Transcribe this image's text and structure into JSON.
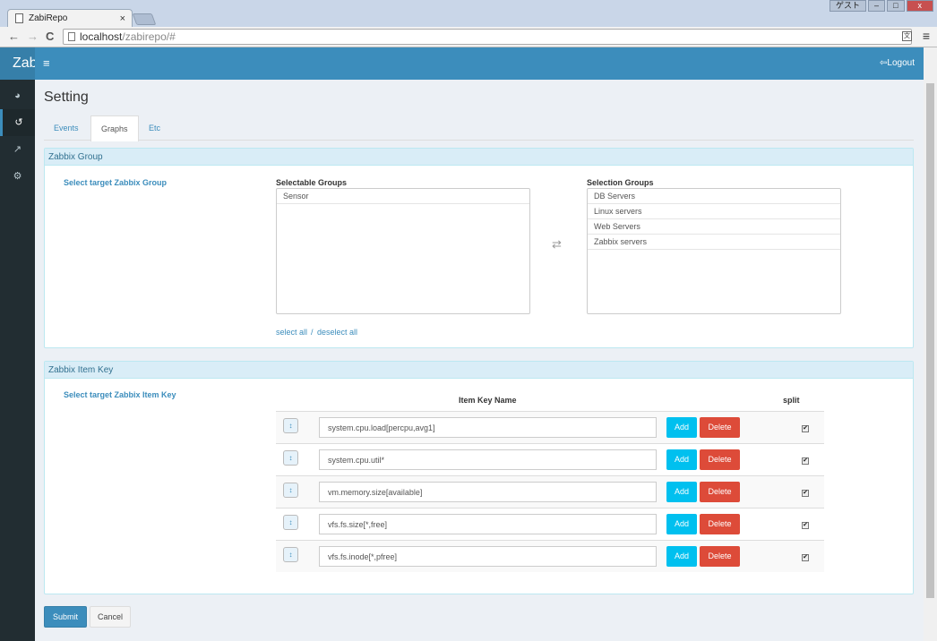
{
  "browser": {
    "tab_title": "ZabiRepo",
    "tab_close": "×",
    "window_buttons": [
      "ゲスト",
      "–",
      "□",
      "x"
    ],
    "address_host": "localhost",
    "address_path": "/zabirepo/#",
    "back": "←",
    "forward": "→",
    "reload": "C",
    "menu": "≡"
  },
  "header": {
    "brand": "Zab",
    "menu_toggle": "≡",
    "logout": "Logout"
  },
  "sidebar": {
    "items": [
      {
        "icon": "dashboard-icon",
        "glyph": "◕"
      },
      {
        "icon": "history-icon",
        "glyph": "↺"
      },
      {
        "icon": "line-chart-icon",
        "glyph": "↗"
      },
      {
        "icon": "cogs-icon",
        "glyph": "⚙"
      }
    ],
    "active_index": 1
  },
  "page": {
    "title": "Setting",
    "tabs": [
      {
        "label": "Events"
      },
      {
        "label": "Graphs",
        "active": true
      },
      {
        "label": "Etc"
      }
    ]
  },
  "group_panel": {
    "heading": "Zabbix Group",
    "target_label": "Select target Zabbix Group",
    "selectable_header": "Selectable Groups",
    "selection_header": "Selection Groups",
    "selectable": [
      "Sensor"
    ],
    "selected": [
      "DB Servers",
      "Linux servers",
      "Web Servers",
      "Zabbix servers"
    ],
    "swap_icon": "⇄",
    "select_all": "select all",
    "separator": "/",
    "deselect_all": "deselect all"
  },
  "item_panel": {
    "heading": "Zabbix Item Key",
    "target_label": "Select target Zabbix Item Key",
    "col_name": "Item Key Name",
    "col_split": "split",
    "add_label": "Add",
    "delete_label": "Delete",
    "handle_glyph": "↕",
    "rows": [
      {
        "key": "system.cpu.load[percpu,avg1]",
        "split": true
      },
      {
        "key": "system.cpu.util*",
        "split": true
      },
      {
        "key": "vm.memory.size[available]",
        "split": true
      },
      {
        "key": "vfs.fs.size[*,free]",
        "split": true
      },
      {
        "key": "vfs.fs.inode[*,pfree]",
        "split": true
      }
    ]
  },
  "actions": {
    "submit": "Submit",
    "cancel": "Cancel"
  },
  "colors": {
    "primary": "#3c8dbc",
    "info": "#00c0ef",
    "danger": "#dd4b39",
    "sidebar": "#222d32",
    "panel_head": "#d9edf7"
  }
}
